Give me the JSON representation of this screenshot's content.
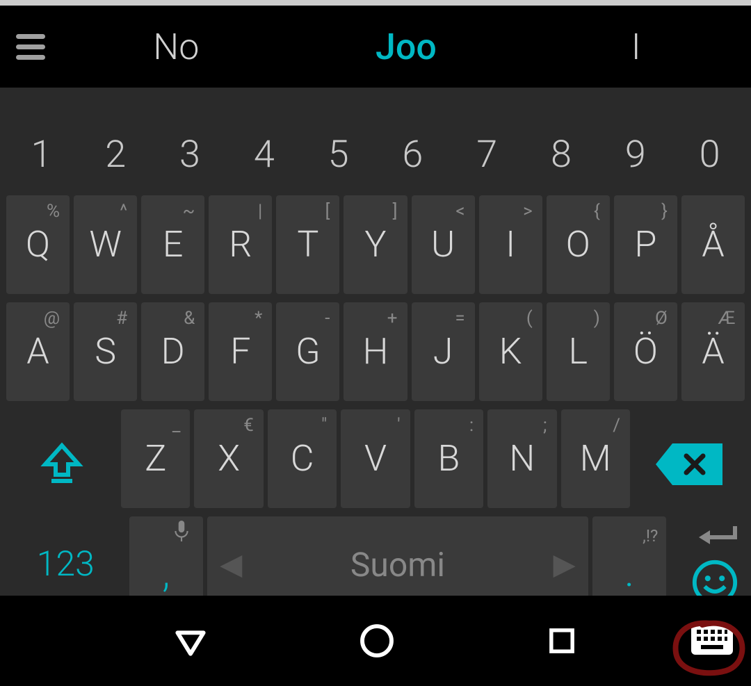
{
  "suggestions": {
    "left": "No",
    "center": "Joo",
    "right": "I"
  },
  "keyboard": {
    "numbers": [
      "1",
      "2",
      "3",
      "4",
      "5",
      "6",
      "7",
      "8",
      "9",
      "0"
    ],
    "row1": [
      {
        "main": "Q",
        "sup": "%"
      },
      {
        "main": "W",
        "sup": "^"
      },
      {
        "main": "E",
        "sup": "~"
      },
      {
        "main": "R",
        "sup": "|"
      },
      {
        "main": "T",
        "sup": "["
      },
      {
        "main": "Y",
        "sup": "]"
      },
      {
        "main": "U",
        "sup": "<"
      },
      {
        "main": "I",
        "sup": ">"
      },
      {
        "main": "O",
        "sup": "{"
      },
      {
        "main": "P",
        "sup": "}"
      },
      {
        "main": "Å",
        "sup": ""
      }
    ],
    "row2": [
      {
        "main": "A",
        "sup": "@"
      },
      {
        "main": "S",
        "sup": "#"
      },
      {
        "main": "D",
        "sup": "&"
      },
      {
        "main": "F",
        "sup": "*"
      },
      {
        "main": "G",
        "sup": "-"
      },
      {
        "main": "H",
        "sup": "+"
      },
      {
        "main": "J",
        "sup": "="
      },
      {
        "main": "K",
        "sup": "("
      },
      {
        "main": "L",
        "sup": ")"
      },
      {
        "main": "Ö",
        "sup": "Ø"
      },
      {
        "main": "Ä",
        "sup": "Æ"
      }
    ],
    "row3": [
      {
        "main": "Z",
        "sup": "_"
      },
      {
        "main": "X",
        "sup": "€"
      },
      {
        "main": "C",
        "sup": "\""
      },
      {
        "main": "V",
        "sup": "'"
      },
      {
        "main": "B",
        "sup": ":"
      },
      {
        "main": "N",
        "sup": ";"
      },
      {
        "main": "M",
        "sup": "/"
      }
    ],
    "sym_label": "123",
    "comma": ",",
    "period": ".",
    "period_sup": ",!?",
    "space_language": "Suomi"
  },
  "colors": {
    "accent": "#00b8c4",
    "bg_keyboard": "#2a2a2a",
    "bg_key": "#3a3a3a"
  }
}
